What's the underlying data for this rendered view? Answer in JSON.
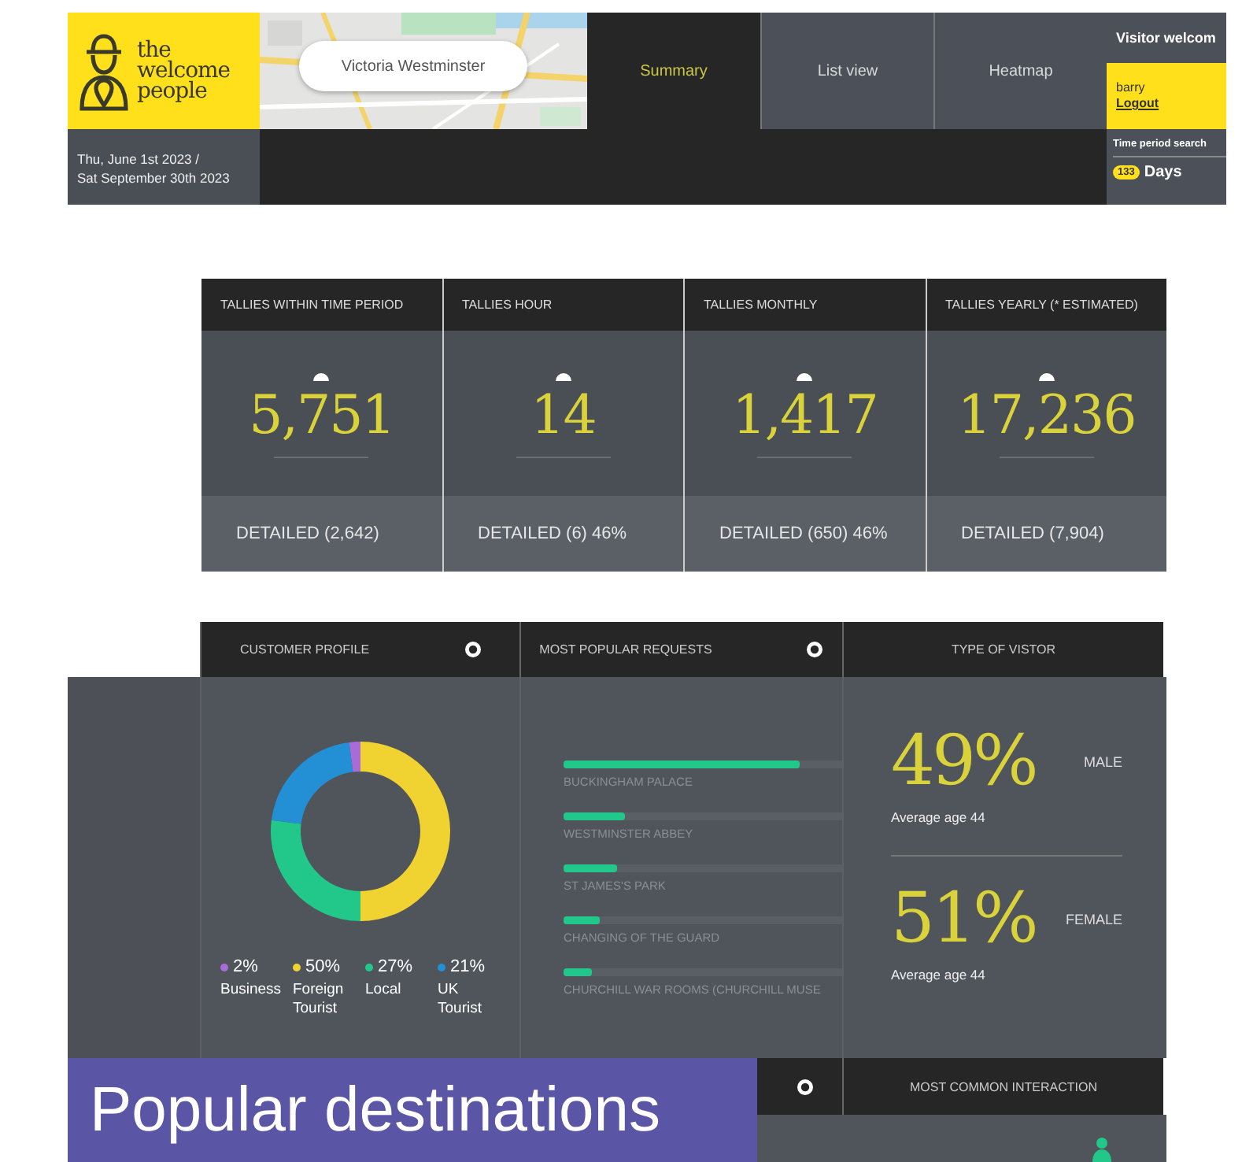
{
  "header": {
    "logo": "the\nwelcome\npeople",
    "search": {
      "value": "Victoria Westminster"
    },
    "tabs": [
      {
        "label": "Summary",
        "selected": true
      },
      {
        "label": "List view",
        "selected": false
      },
      {
        "label": "Heatmap",
        "selected": false
      }
    ],
    "visitor": {
      "title": "Visitor welcom",
      "user": "barry",
      "logout": "Logout"
    },
    "date_range": "Thu, June 1st 2023 /\nSat September 30th 2023",
    "time_period": {
      "label": "Time period search",
      "count": "133",
      "unit": "Days"
    }
  },
  "tallies": [
    {
      "title": "TALLIES WITHIN TIME PERIOD",
      "value": "5,751",
      "detail": "DETAILED (2,642)"
    },
    {
      "title": "TALLIES HOUR",
      "value": "14",
      "detail": "DETAILED (6) 46%"
    },
    {
      "title": "TALLIES MONTHLY",
      "value": "1,417",
      "detail": "DETAILED (650) 46%"
    },
    {
      "title": "TALLIES YEARLY (* ESTIMATED)",
      "value": "17,236",
      "detail": "DETAILED (7,904)"
    }
  ],
  "panels": [
    {
      "kind": "donut",
      "title": "CUSTOMER PROFILE",
      "chart_data": {
        "type": "donut",
        "categories": [
          "Business",
          "Foreign Tourist",
          "Local",
          "UK Tourist"
        ],
        "values": [
          2,
          50,
          27,
          21
        ]
      },
      "legend": [
        {
          "value": "2%",
          "color": "#a86bd8"
        },
        {
          "value": "50%",
          "color": "#f0d230"
        },
        {
          "value": "27%",
          "color": "#22c88a"
        },
        {
          "value": "21%",
          "color": "#2390d6"
        }
      ]
    },
    {
      "kind": "bars",
      "title": "MOST POPULAR REQUESTS",
      "items": [
        {
          "label": "BUCKINGHAM PALACE",
          "level": 0.84
        },
        {
          "label": "WESTMINSTER ABBEY",
          "level": 0.22
        },
        {
          "label": "ST JAMES'S PARK",
          "level": 0.19
        },
        {
          "label": "CHANGING OF THE GUARD",
          "level": 0.13
        },
        {
          "label": "CHURCHILL WAR ROOMS (CHURCHILL MUSE",
          "level": 0.1
        }
      ]
    },
    {
      "kind": "visitor",
      "title": "TYPE OF VISTOR",
      "groups": [
        {
          "percent": "49%",
          "gender": "MALE",
          "note": "Average age 44"
        },
        {
          "percent": "51%",
          "gender": "FEMALE",
          "note": "Average age 44"
        }
      ]
    }
  ],
  "interaction": {
    "title": "MOST COMMON INTERACTION"
  },
  "caption": "Popular destinations"
}
